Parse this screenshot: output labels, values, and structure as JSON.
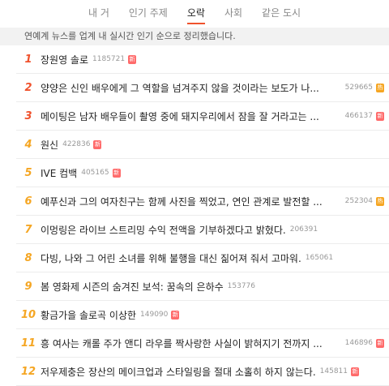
{
  "tabs": [
    {
      "label": "내 거",
      "active": false
    },
    {
      "label": "인기 주제",
      "active": false
    },
    {
      "label": "오락",
      "active": true
    },
    {
      "label": "사회",
      "active": false
    },
    {
      "label": "같은 도시",
      "active": false
    }
  ],
  "notice": "연예계 뉴스를 업계 내 실시간 인기 순으로 정리했습니다.",
  "accent_color": "#f0522d",
  "items": [
    {
      "rank": "1",
      "title": "장원영 솔로",
      "count": "1185721",
      "badge": "新",
      "badge_type": "new"
    },
    {
      "rank": "2",
      "title": "양양은 신인 배우에게 그 역할을 넘겨주지 않을 것이라는 보도가 나...",
      "count": "529665",
      "badge": "热",
      "badge_type": "hot"
    },
    {
      "rank": "3",
      "title": "메이팅은 남자 배우들이 촬영 중에 돼지우리에서 잠을 잘 거라고는 ...",
      "count": "466137",
      "badge": "新",
      "badge_type": "new"
    },
    {
      "rank": "4",
      "title": "원신",
      "count": "422836",
      "badge": "新",
      "badge_type": "new"
    },
    {
      "rank": "5",
      "title": "IVE 컴백",
      "count": "405165",
      "badge": "新",
      "badge_type": "new"
    },
    {
      "rank": "6",
      "title": "예푸신과 그의 여자친구는 함께 사진을 찍었고, 연인 관계로 발전할 ...",
      "count": "252304",
      "badge": "热",
      "badge_type": "hot"
    },
    {
      "rank": "7",
      "title": "이멍링은 라이브 스트리밍 수익 전액을 기부하겠다고 밝혔다.",
      "count": "206391",
      "badge": "",
      "badge_type": ""
    },
    {
      "rank": "8",
      "title": "다빙, 나와 그 어린 소녀를 위해 불행을 대신 짊어져 줘서 고마워.",
      "count": "165061",
      "badge": "",
      "badge_type": ""
    },
    {
      "rank": "9",
      "title": "봄 영화제 시즌의 숨겨진 보석: 꿈속의 은하수",
      "count": "153776",
      "badge": "",
      "badge_type": ""
    },
    {
      "rank": "10",
      "title": "황금가을 솔로곡 이상한",
      "count": "149090",
      "badge": "新",
      "badge_type": "new"
    },
    {
      "rank": "11",
      "title": "흥 여사는 캐롤 주가 앤디 라우를 짝사랑한 사실이 밝혀지기 전까지 ...",
      "count": "146896",
      "badge": "新",
      "badge_type": "new"
    },
    {
      "rank": "12",
      "title": "저우제충은 장산의 메이크업과 스타일링을 절대 소홀히 하지 않는다.",
      "count": "145811",
      "badge": "新",
      "badge_type": "new"
    }
  ]
}
